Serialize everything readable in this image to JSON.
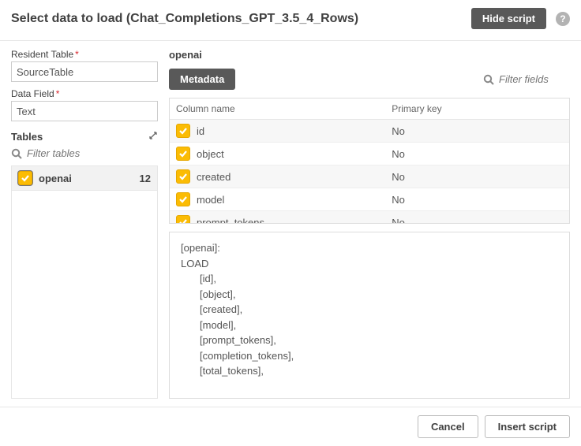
{
  "header": {
    "title": "Select data to load (Chat_Completions_GPT_3.5_4_Rows)",
    "hide_script_label": "Hide script"
  },
  "left": {
    "resident_table_label": "Resident Table",
    "resident_table_value": "SourceTable",
    "data_field_label": "Data Field",
    "data_field_value": "Text",
    "tables_label": "Tables",
    "filter_tables_placeholder": "Filter tables",
    "tables": [
      {
        "name": "openai",
        "count": "12"
      }
    ]
  },
  "right": {
    "selected_table": "openai",
    "metadata_label": "Metadata",
    "filter_fields_placeholder": "Filter fields",
    "col_header_name": "Column name",
    "col_header_pk": "Primary key",
    "columns": [
      {
        "name": "id",
        "pk": "No"
      },
      {
        "name": "object",
        "pk": "No"
      },
      {
        "name": "created",
        "pk": "No"
      },
      {
        "name": "model",
        "pk": "No"
      },
      {
        "name": "prompt_tokens",
        "pk": "No"
      }
    ],
    "script_lines": [
      {
        "text": "[openai]:",
        "indent": 0
      },
      {
        "text": "LOAD",
        "indent": 0
      },
      {
        "text": "[id],",
        "indent": 1
      },
      {
        "text": "[object],",
        "indent": 1
      },
      {
        "text": "[created],",
        "indent": 1
      },
      {
        "text": "[model],",
        "indent": 1
      },
      {
        "text": "[prompt_tokens],",
        "indent": 1
      },
      {
        "text": "[completion_tokens],",
        "indent": 1
      },
      {
        "text": "[total_tokens],",
        "indent": 1
      }
    ]
  },
  "footer": {
    "cancel_label": "Cancel",
    "insert_label": "Insert script"
  }
}
